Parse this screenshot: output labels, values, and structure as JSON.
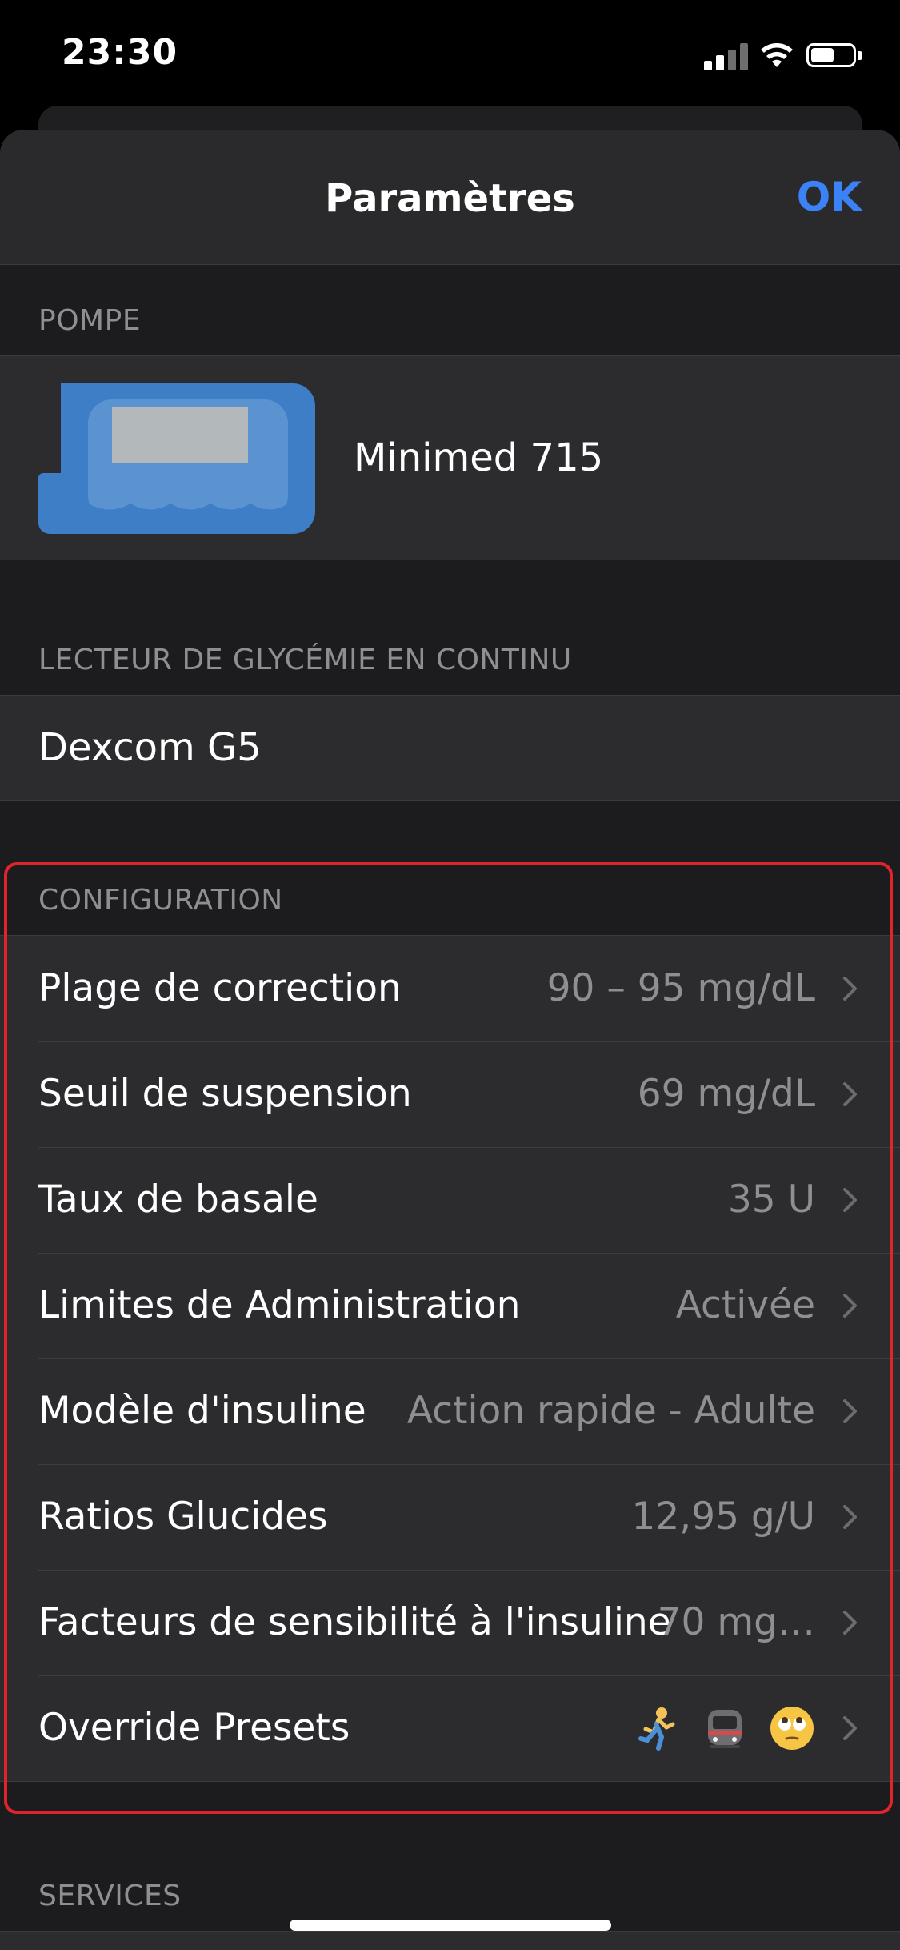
{
  "status": {
    "time": "23:30"
  },
  "nav": {
    "title": "Paramètres",
    "done": "OK"
  },
  "pump_section": {
    "header": "POMPE",
    "name": "Minimed 715"
  },
  "cgm_section": {
    "header": "LECTEUR DE GLYCÉMIE EN CONTINU",
    "name": "Dexcom G5"
  },
  "config_section": {
    "header": "CONFIGURATION",
    "rows": [
      {
        "label": "Plage de correction",
        "value": "90 – 95 mg/dL"
      },
      {
        "label": "Seuil de suspension",
        "value": "69 mg/dL"
      },
      {
        "label": "Taux de basale",
        "value": "35 U"
      },
      {
        "label": "Limites de Administration",
        "value": "Activée"
      },
      {
        "label": "Modèle d'insuline",
        "value": "Action rapide - Adulte"
      },
      {
        "label": "Ratios Glucides",
        "value": "12,95 g/U"
      },
      {
        "label": "Facteurs de sensibilité à l'insuline",
        "value": "70 mg…"
      },
      {
        "label": "Override Presets",
        "value": ""
      }
    ]
  },
  "services_section": {
    "header": "SERVICES"
  },
  "colors": {
    "accent": "#3b82f6",
    "highlight_border": "#e0242b",
    "background": "#1c1c1e",
    "cell": "#2c2c2e"
  }
}
